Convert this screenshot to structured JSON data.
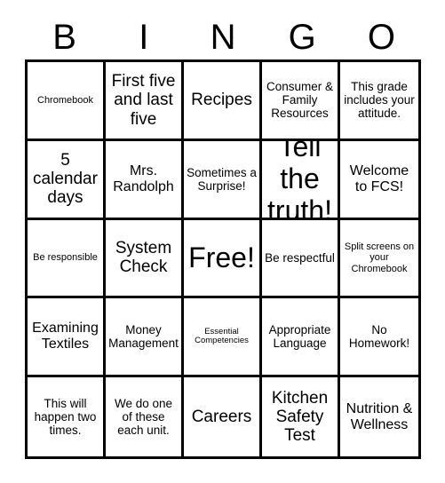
{
  "header": {
    "letters": [
      "B",
      "I",
      "N",
      "G",
      "O"
    ]
  },
  "grid": {
    "rows": [
      [
        {
          "text": "Chromebook",
          "size": "t-sm"
        },
        {
          "text": "First five and last five",
          "size": "t-xl"
        },
        {
          "text": "Recipes",
          "size": "t-xl"
        },
        {
          "text": "Consumer & Family Resources",
          "size": "t-md"
        },
        {
          "text": "This grade includes your attitude.",
          "size": "t-md"
        }
      ],
      [
        {
          "text": "5 calendar days",
          "size": "t-xl"
        },
        {
          "text": "Mrs. Randolph",
          "size": "t-lg"
        },
        {
          "text": "Sometimes a Surprise!",
          "size": "t-md"
        },
        {
          "text": "Tell the truth!",
          "size": "t-xxl"
        },
        {
          "text": "Welcome to FCS!",
          "size": "t-lg"
        }
      ],
      [
        {
          "text": "Be responsible",
          "size": "t-sm"
        },
        {
          "text": "System Check",
          "size": "t-xl"
        },
        {
          "text": "Free!",
          "size": "t-xxl"
        },
        {
          "text": "Be respectful",
          "size": "t-md"
        },
        {
          "text": "Split screens on your Chromebook",
          "size": "t-sm"
        }
      ],
      [
        {
          "text": "Examining Textiles",
          "size": "t-lg"
        },
        {
          "text": "Money Management",
          "size": "t-md"
        },
        {
          "text": "Essential Competencies",
          "size": "t-xs"
        },
        {
          "text": "Appropriate Language",
          "size": "t-md"
        },
        {
          "text": "No Homework!",
          "size": "t-md"
        }
      ],
      [
        {
          "text": "This will happen two times.",
          "size": "t-md"
        },
        {
          "text": "We do one of these each unit.",
          "size": "t-md"
        },
        {
          "text": "Careers",
          "size": "t-xl"
        },
        {
          "text": "Kitchen Safety Test",
          "size": "t-xl"
        },
        {
          "text": "Nutrition & Wellness",
          "size": "t-lg"
        }
      ]
    ]
  },
  "colors": {
    "border": "#000000",
    "background": "#ffffff",
    "text": "#000000"
  }
}
